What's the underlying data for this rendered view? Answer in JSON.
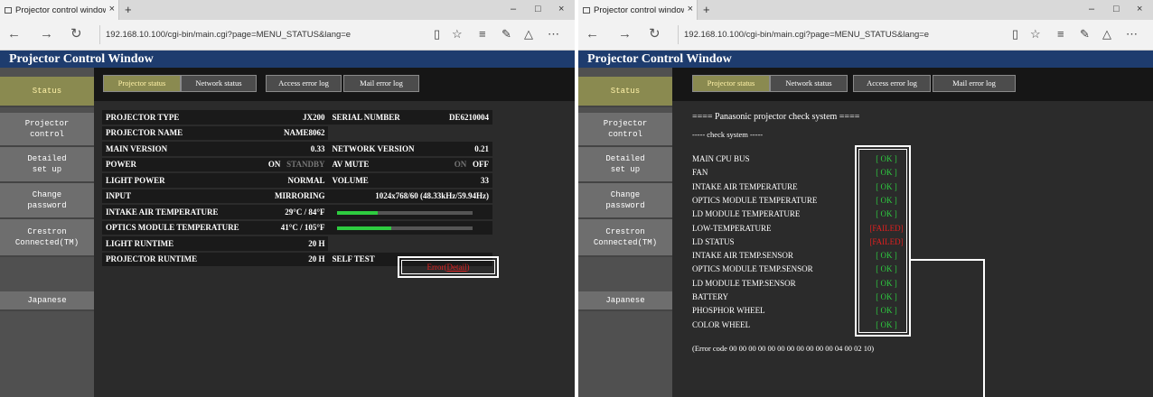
{
  "browser": {
    "tab_title": "Projector control window",
    "new_tab": "+",
    "url": "192.168.10.100/cgi-bin/main.cgi?page=MENU_STATUS&lang=e",
    "nav_back": "←",
    "nav_forward": "→",
    "nav_refresh": "↻",
    "win_min": "–",
    "win_max": "□",
    "win_close": "×",
    "tab_close": "×"
  },
  "page": {
    "header": "Projector Control Window"
  },
  "sidebar": {
    "items": [
      {
        "label": "Status"
      },
      {
        "label": "Projector control"
      },
      {
        "label": "Detailed set up"
      },
      {
        "label": "Change password"
      },
      {
        "label": "Crestron Connected(TM)"
      },
      {
        "label": "Japanese"
      }
    ]
  },
  "tabs": [
    {
      "label": "Projector status"
    },
    {
      "label": "Network status"
    },
    {
      "label": "Access error log"
    },
    {
      "label": "Mail error log"
    }
  ],
  "status": {
    "projector_type_label": "PROJECTOR TYPE",
    "projector_type": "JX200",
    "serial_label": "SERIAL NUMBER",
    "serial": "DE6210004",
    "projector_name_label": "PROJECTOR NAME",
    "projector_name": "NAME8062",
    "main_version_label": "MAIN VERSION",
    "main_version": "0.33",
    "network_version_label": "NETWORK VERSION",
    "network_version": "0.21",
    "power_label": "POWER",
    "power_on": "ON",
    "power_standby": "STANDBY",
    "av_mute_label": "AV MUTE",
    "av_mute_on": "ON",
    "av_mute_off": "OFF",
    "light_power_label": "LIGHT POWER",
    "light_power": "NORMAL",
    "volume_label": "VOLUME",
    "volume": "33",
    "input_label": "INPUT",
    "input": "MIRRORING",
    "input_signal": "1024x768/60 (48.33kHz/59.94Hz)",
    "intake_temp_label": "INTAKE AIR TEMPERATURE",
    "intake_temp": "29°C / 84°F",
    "intake_temp_level": 0.3,
    "optics_temp_label": "OPTICS MODULE TEMPERATURE",
    "optics_temp": "41°C / 105°F",
    "optics_temp_level": 0.4,
    "light_runtime_label": "LIGHT RUNTIME",
    "light_runtime": "20 H",
    "projector_runtime_label": "PROJECTOR RUNTIME",
    "projector_runtime": "20 H",
    "self_test_label": "SELF TEST",
    "self_test_error": "Error(",
    "self_test_detail": "Detail",
    "self_test_close": ")"
  },
  "check": {
    "title": "==== Panasonic projector check system ====",
    "subtitle": "----- check system -----",
    "items": [
      {
        "name": "MAIN CPU BUS",
        "result": "[ OK ]"
      },
      {
        "name": "FAN",
        "result": "[ OK ]"
      },
      {
        "name": "INTAKE AIR TEMPERATURE",
        "result": "[ OK ]"
      },
      {
        "name": "OPTICS MODULE TEMPERATURE",
        "result": "[ OK ]"
      },
      {
        "name": "LD MODULE TEMPERATURE",
        "result": "[ OK ]"
      },
      {
        "name": "LOW-TEMPERATURE",
        "result": "[FAILED]"
      },
      {
        "name": "LD STATUS",
        "result": "[FAILED]"
      },
      {
        "name": "INTAKE AIR TEMP.SENSOR",
        "result": "[ OK ]"
      },
      {
        "name": "OPTICS MODULE TEMP.SENSOR",
        "result": "[ OK ]"
      },
      {
        "name": "LD MODULE TEMP.SENSOR",
        "result": "[ OK ]"
      },
      {
        "name": "BATTERY",
        "result": "[ OK ]"
      },
      {
        "name": "PHOSPHOR WHEEL",
        "result": "[ OK ]"
      },
      {
        "name": "COLOR WHEEL",
        "result": "[ OK ]"
      }
    ],
    "error_code": "(Error code 00 00 00 00 00 00 00 00 00 00 00 04 00 02 10)"
  },
  "colors": {
    "header_bg": "#1e3c6e",
    "ok": "#2ecc40",
    "failed": "#e02020",
    "active_tab": "#8a8a50"
  }
}
